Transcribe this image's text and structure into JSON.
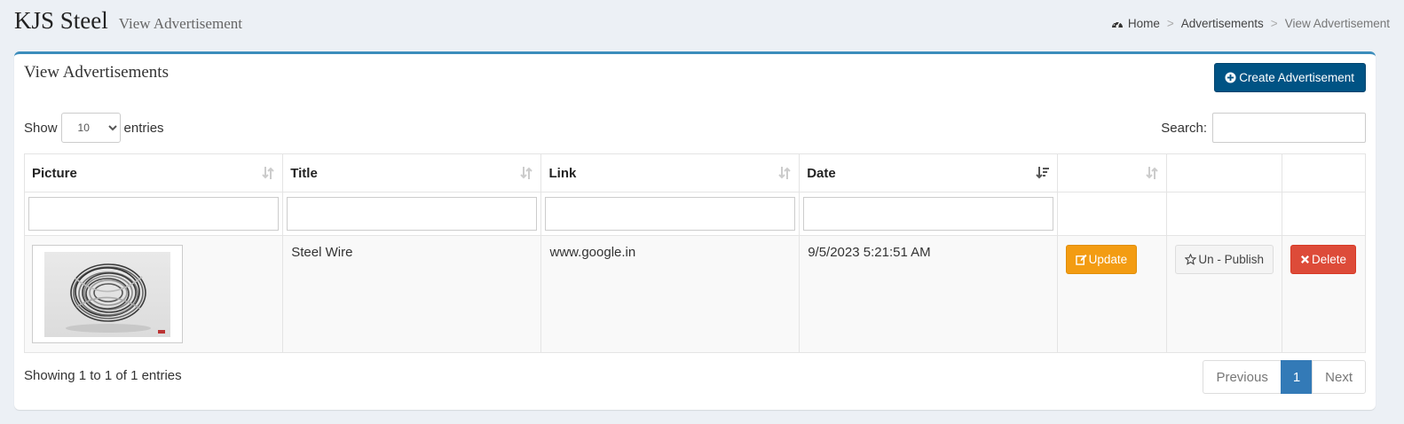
{
  "header": {
    "brand": "KJS Steel",
    "subtitle": "View Advertisement"
  },
  "breadcrumb": [
    {
      "label": "Home",
      "icon": "dashboard-icon"
    },
    {
      "label": "Advertisements"
    },
    {
      "label": "View Advertisement"
    }
  ],
  "box": {
    "title": "View Advertisements",
    "create_label": "Create Advertisement"
  },
  "length": {
    "show_label": "Show",
    "entries_label": "entries",
    "selected": "10",
    "options": [
      "10"
    ]
  },
  "search": {
    "label": "Search:",
    "value": ""
  },
  "table": {
    "columns": [
      "Picture",
      "Title",
      "Link",
      "Date",
      "",
      "",
      ""
    ],
    "rows": [
      {
        "picture": "steel-wire-coil-image",
        "title": "Steel Wire",
        "link": "www.google.in",
        "date": "9/5/2023 5:21:51 AM",
        "update_label": "Update",
        "unpublish_label": "Un - Publish",
        "delete_label": "Delete"
      }
    ]
  },
  "info": "Showing 1 to 1 of 1 entries",
  "pagination": {
    "previous": "Previous",
    "current": "1",
    "next": "Next"
  },
  "colors": {
    "primary": "#005384",
    "accent_border": "#3c8dbc",
    "update": "#f39c12",
    "delete": "#dd4b39",
    "active_page": "#337ab7"
  }
}
